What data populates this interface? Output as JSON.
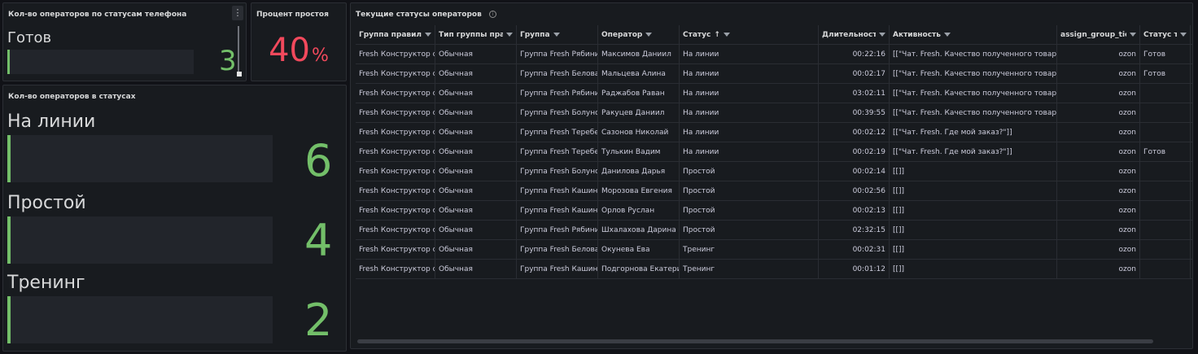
{
  "colors": {
    "green": "#73bf69",
    "red": "#f2495c",
    "panel_bg": "#181b1f",
    "bar_bg": "#22252b"
  },
  "panel_phone_status": {
    "title": "Кол-во операторов по статусам телефона",
    "menu_icon": "kebab-menu-icon",
    "items": [
      {
        "label": "Готов",
        "value": "3"
      }
    ]
  },
  "panel_idle": {
    "title": "Процент простоя",
    "value": "40",
    "unit": "%"
  },
  "panel_statuses": {
    "title": "Кол-во операторов в статусах",
    "items": [
      {
        "label": "На линии",
        "value": "6"
      },
      {
        "label": "Простой",
        "value": "4"
      },
      {
        "label": "Тренинг",
        "value": "2"
      }
    ]
  },
  "panel_table": {
    "title": "Текущие статусы операторов",
    "info_icon": "i",
    "columns": [
      {
        "label": "Группа правил"
      },
      {
        "label": "Тип группы правил"
      },
      {
        "label": "Группа"
      },
      {
        "label": "Оператор"
      },
      {
        "label": "Статус",
        "sort": "↑"
      },
      {
        "label": "Длительность"
      },
      {
        "label": "Активность"
      },
      {
        "label": "assign_group_ticket"
      },
      {
        "label": "Статус телефона"
      }
    ],
    "rows": [
      [
        "Fresh Конструктор операторов",
        "Обычная",
        "Группа Fresh Рябинина",
        "Максимов Даниил",
        "На линии",
        "00:22:16",
        "[[\"Чат. Fresh. Качество полученного товара\"]]",
        "ozon",
        "Готов"
      ],
      [
        "Fresh Конструктор операторов",
        "Обычная",
        "Группа Fresh Белова",
        "Мальцева Алина",
        "На линии",
        "00:02:17",
        "[[\"Чат. Fresh. Качество полученного товара\"]]",
        "ozon",
        "Готов"
      ],
      [
        "Fresh Конструктор операторов",
        "Обычная",
        "Группа Fresh Рябинина",
        "Раджабов Раван",
        "На линии",
        "03:02:11",
        "[[\"Чат. Fresh. Качество полученного товара\"]]",
        "ozon",
        ""
      ],
      [
        "Fresh Конструктор операторов",
        "Обычная",
        "Группа Fresh Болунова",
        "Ракуцев Даниил",
        "На линии",
        "00:39:55",
        "[[\"Чат. Fresh. Качество полученного товара\"]]",
        "ozon",
        ""
      ],
      [
        "Fresh Конструктор операторов",
        "Обычная",
        "Группа Fresh Теребенина",
        "Сазонов Николай",
        "На линии",
        "00:02:12",
        "[[\"Чат. Fresh. Где мой заказ?\"]]",
        "ozon",
        ""
      ],
      [
        "Fresh Конструктор операторов",
        "Обычная",
        "Группа Fresh Теребенина",
        "Тулькин Вадим",
        "На линии",
        "00:02:19",
        "[[\"Чат. Fresh. Где мой заказ?\"]]",
        "ozon",
        "Готов"
      ],
      [
        "Fresh Конструктор операторов",
        "Обычная",
        "Группа Fresh Болунова",
        "Данилова Дарья",
        "Простой",
        "00:02:14",
        "[[]]",
        "ozon",
        ""
      ],
      [
        "Fresh Конструктор операторов",
        "Обычная",
        "Группа Fresh Кашина",
        "Морозова Евгения",
        "Простой",
        "00:02:56",
        "[[]]",
        "ozon",
        ""
      ],
      [
        "Fresh Конструктор операторов",
        "Обычная",
        "Группа Fresh Кашина",
        "Орлов Руслан",
        "Простой",
        "00:02:13",
        "[[]]",
        "ozon",
        ""
      ],
      [
        "Fresh Конструктор операторов",
        "Обычная",
        "Группа Fresh Рябинина",
        "Шхалахова Дарина",
        "Простой",
        "02:32:15",
        "[[]]",
        "ozon",
        ""
      ],
      [
        "Fresh Конструктор операторов",
        "Обычная",
        "Группа Fresh Белова",
        "Окунева Ева",
        "Тренинг",
        "00:02:31",
        "[[]]",
        "ozon",
        ""
      ],
      [
        "Fresh Конструктор операторов",
        "Обычная",
        "Группа Fresh Кашина",
        "Подгорнова Екатерина",
        "Тренинг",
        "00:01:12",
        "[[]]",
        "ozon",
        ""
      ]
    ]
  }
}
